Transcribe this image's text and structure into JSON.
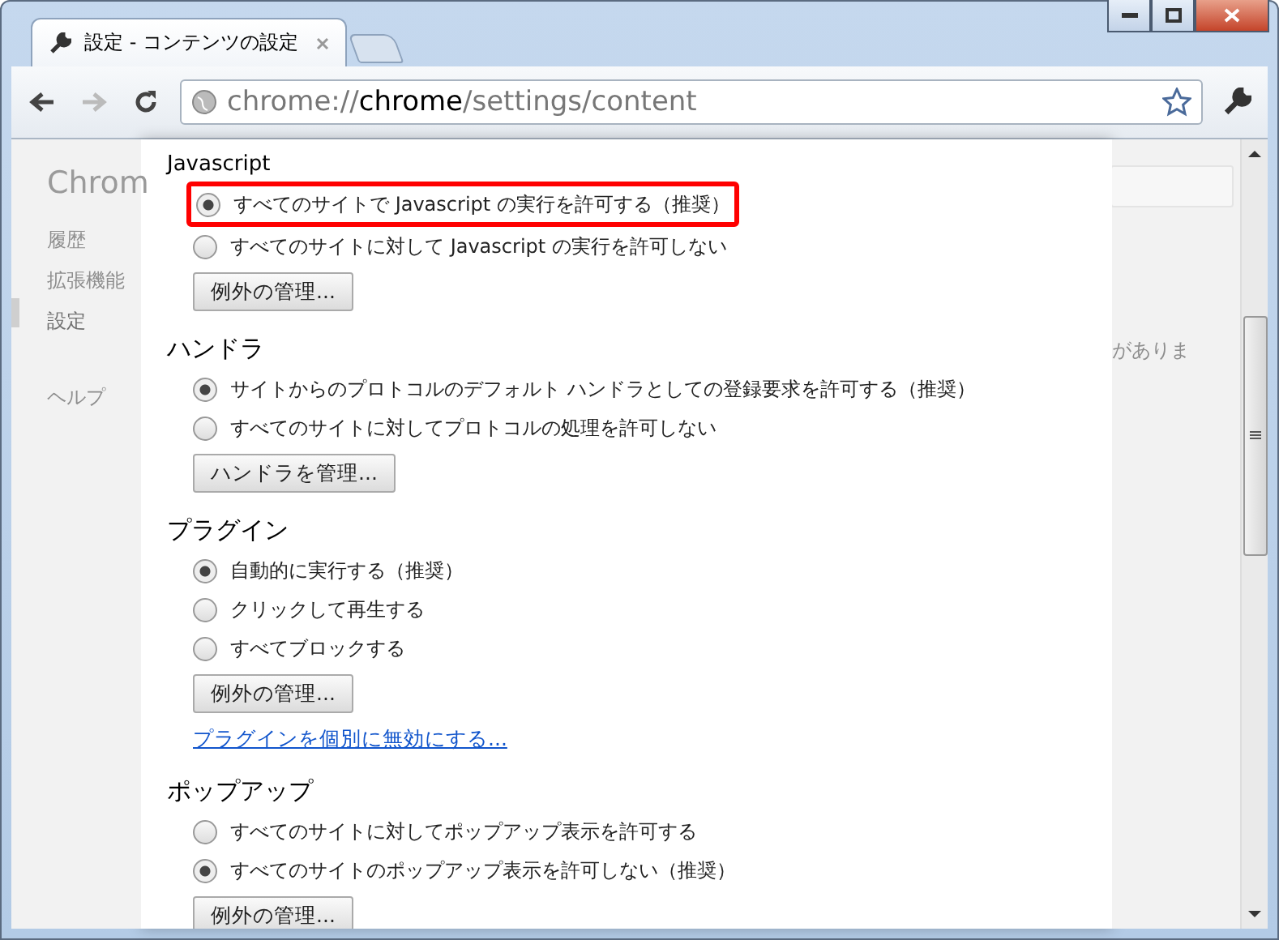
{
  "tab": {
    "title": "設定 - コンテンツの設定"
  },
  "address": {
    "scheme": "chrome://",
    "host": "chrome",
    "path": "/settings/content"
  },
  "background_page": {
    "title": "Chrom",
    "sidebar": [
      {
        "label": "履歴",
        "selected": false
      },
      {
        "label": "拡張機能",
        "selected": false
      },
      {
        "label": "設定",
        "selected": true
      },
      {
        "label": "ヘルプ",
        "selected": false
      }
    ],
    "right_text": "がありま"
  },
  "sections": [
    {
      "heading": "Javascript",
      "options": [
        {
          "label": "すべてのサイトで Javascript の実行を許可する（推奨）",
          "selected": true,
          "highlighted": true
        },
        {
          "label": "すべてのサイトに対して Javascript の実行を許可しない",
          "selected": false,
          "highlighted": false
        }
      ],
      "button": "例外の管理..."
    },
    {
      "heading": "ハンドラ",
      "options": [
        {
          "label": "サイトからのプロトコルのデフォルト ハンドラとしての登録要求を許可する（推奨）",
          "selected": true,
          "highlighted": false
        },
        {
          "label": "すべてのサイトに対してプロトコルの処理を許可しない",
          "selected": false,
          "highlighted": false
        }
      ],
      "button": "ハンドラを管理..."
    },
    {
      "heading": "プラグイン",
      "options": [
        {
          "label": "自動的に実行する（推奨）",
          "selected": true,
          "highlighted": false
        },
        {
          "label": "クリックして再生する",
          "selected": false,
          "highlighted": false
        },
        {
          "label": "すべてブロックする",
          "selected": false,
          "highlighted": false
        }
      ],
      "button": "例外の管理...",
      "link": "プラグインを個別に無効にする..."
    },
    {
      "heading": "ポップアップ",
      "options": [
        {
          "label": "すべてのサイトに対してポップアップ表示を許可する",
          "selected": false,
          "highlighted": false
        },
        {
          "label": "すべてのサイトのポップアップ表示を許可しない（推奨）",
          "selected": true,
          "highlighted": false
        }
      ],
      "button": "例外の管理..."
    }
  ]
}
